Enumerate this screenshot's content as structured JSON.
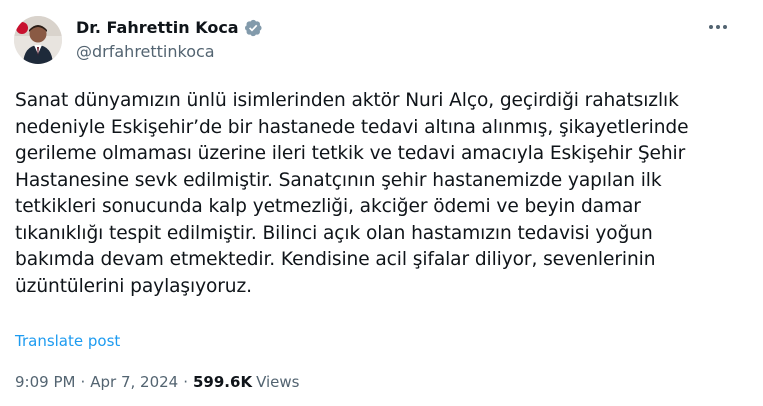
{
  "author": {
    "display_name": "Dr. Fahrettin Koca",
    "handle": "@drfahrettinkoca",
    "verified": true,
    "verified_color": "#829aab",
    "avatar_icon": "profile-photo"
  },
  "more_icon": "more-horizontal-icon",
  "post": {
    "lines": [
      "Sanat dünyamızın ünlü isimlerinden aktör Nuri Alço, geçirdiği rahatsızlık",
      "nedeniyle Eskişehir’de bir hastanede tedavi altına alınmış, şikayetlerinde",
      "gerileme olmaması üzerine ileri tetkik ve tedavi amacıyla Eskişehir Şehir",
      "Hastanesine sevk edilmiştir. Sanatçının şehir hastanemizde yapılan ilk",
      "tetkikleri sonucunda kalp yetmezliği, akciğer ödemi ve beyin damar",
      "tıkanıklığı tespit edilmiştir. Bilinci açık olan hastamızın tedavisi yoğun",
      "bakımda devam etmektedir. Kendisine acil şifalar diliyor, sevenlerinin",
      "üzüntülerini paylaşıyoruz."
    ],
    "translate_label": "Translate post",
    "time": "9:09 PM",
    "separator": "·",
    "date": "Apr 7, 2024",
    "view_count": "599.6K",
    "views_label": "Views"
  },
  "colors": {
    "text": "#0f1419",
    "secondary": "#536471",
    "link": "#1d9bf0"
  }
}
